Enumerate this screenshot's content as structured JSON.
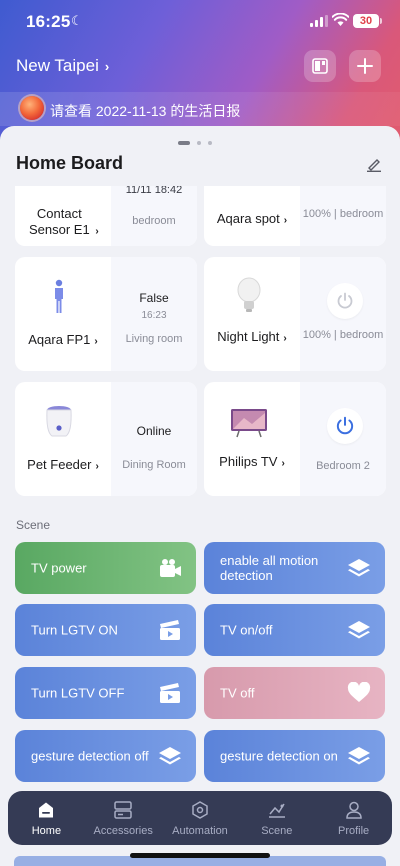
{
  "status": {
    "time": "16:25",
    "battery": "30"
  },
  "header": {
    "location": "New Taipei"
  },
  "banner": {
    "text": "请查看 2022-11-13 的生活日报"
  },
  "board": {
    "title": "Home Board"
  },
  "devices": [
    {
      "name": "Contact Sensor E1",
      "value": "11/11 18:42",
      "room": "bedroom"
    },
    {
      "name": "Aqara spot",
      "value": "",
      "room": "100% | bedroom"
    },
    {
      "name": "Aqara FP1",
      "value": "False",
      "sub": "16:23",
      "room": "Living room"
    },
    {
      "name": "Night Light",
      "value": "",
      "room": "100% | bedroom"
    },
    {
      "name": "Pet Feeder",
      "value": "Online",
      "room": "Dining Room"
    },
    {
      "name": "Philips TV",
      "value": "",
      "room": "Bedroom 2"
    }
  ],
  "scene_section": {
    "label": "Scene"
  },
  "scenes": [
    {
      "label": "TV power",
      "icon": "video-camera-icon",
      "color": "#6bb570"
    },
    {
      "label": "enable all motion detection",
      "icon": "layers-icon",
      "color": "#6a90df"
    },
    {
      "label": "Turn LGTV ON",
      "icon": "clapperboard-icon",
      "color": "#6a90df"
    },
    {
      "label": "TV on/off",
      "icon": "layers-icon",
      "color": "#6a90df"
    },
    {
      "label": "Turn LGTV OFF",
      "icon": "clapperboard-icon",
      "color": "#6a90df"
    },
    {
      "label": "TV off",
      "icon": "heart-icon",
      "color": "#dfa7b8"
    },
    {
      "label": "gesture detection off",
      "icon": "layers-icon",
      "color": "#6a90df"
    },
    {
      "label": "gesture detection on",
      "icon": "layers-icon",
      "color": "#6a90df"
    }
  ],
  "tabs": [
    {
      "label": "Home",
      "active": true
    },
    {
      "label": "Accessories"
    },
    {
      "label": "Automation"
    },
    {
      "label": "Scene"
    },
    {
      "label": "Profile"
    }
  ]
}
